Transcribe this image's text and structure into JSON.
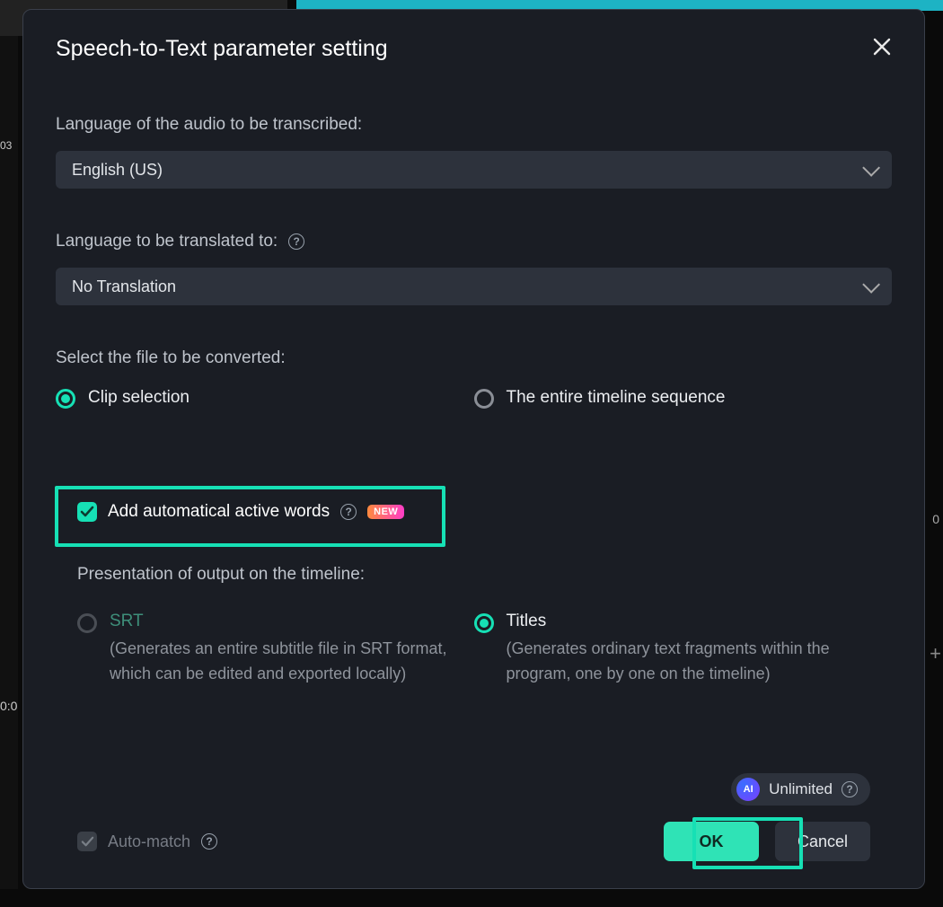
{
  "bg": {
    "ts1": "03",
    "ts2": "0:0",
    "sidezero": "0",
    "plus": "+"
  },
  "modal": {
    "title": "Speech-to-Text parameter setting",
    "section_language": "Language of the audio to be transcribed:",
    "language_value": "English (US)",
    "section_translate": "Language to be translated to:",
    "translate_value": "No Translation",
    "section_file": "Select the file to be converted:",
    "file_opts": {
      "clip": "Clip selection",
      "timeline": "The entire timeline sequence"
    },
    "active_words": {
      "label": "Add automatical active words",
      "badge": "NEW"
    },
    "section_presentation": "Presentation of output on the timeline:",
    "presentation": {
      "srt": {
        "label": "SRT",
        "desc": "(Generates an entire subtitle file in SRT format, which can be edited and exported locally)"
      },
      "titles": {
        "label": "Titles",
        "desc": "(Generates ordinary text fragments within the program, one by one on the timeline)"
      }
    },
    "unlimited": "Unlimited",
    "automatch": "Auto-match",
    "buttons": {
      "ok": "OK",
      "cancel": "Cancel"
    }
  }
}
